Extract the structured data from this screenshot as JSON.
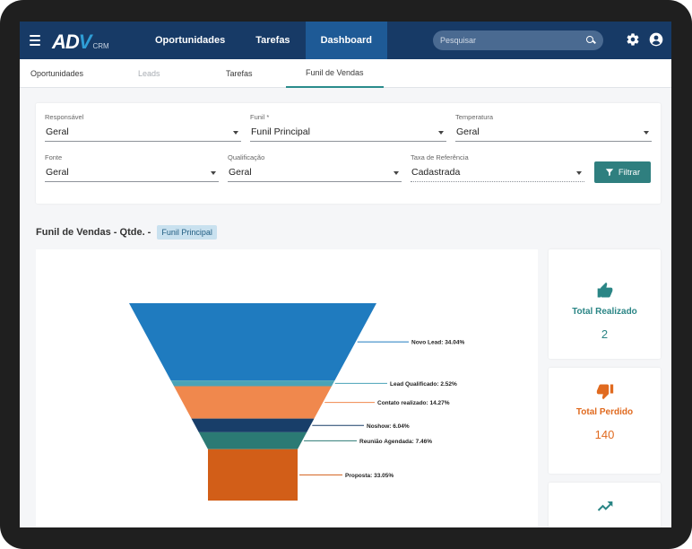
{
  "app": {
    "logo_text": "ADV",
    "logo_suffix": "CRM"
  },
  "nav": {
    "items": [
      {
        "label": "Oportunidades",
        "active": false
      },
      {
        "label": "Tarefas",
        "active": false
      },
      {
        "label": "Dashboard",
        "active": true
      }
    ]
  },
  "search": {
    "placeholder": "Pesquisar"
  },
  "subnav": {
    "tabs": [
      {
        "label": "Oportunidades",
        "state": "normal"
      },
      {
        "label": "Leads",
        "state": "disabled"
      },
      {
        "label": "Tarefas",
        "state": "normal"
      },
      {
        "label": "Funil de Vendas",
        "state": "active"
      }
    ]
  },
  "filters": {
    "responsavel": {
      "label": "Responsável",
      "value": "Geral"
    },
    "funil": {
      "label": "Funil *",
      "value": "Funil Principal"
    },
    "temperatura": {
      "label": "Temperatura",
      "value": "Geral"
    },
    "fonte": {
      "label": "Fonte",
      "value": "Geral"
    },
    "qualificacao": {
      "label": "Qualificação",
      "value": "Geral"
    },
    "taxa": {
      "label": "Taxa de Referência",
      "value": "Cadastrada"
    },
    "button_label": "Filtrar"
  },
  "section": {
    "title": "Funil de Vendas - Qtde. -",
    "badge": "Funil Principal"
  },
  "kpis": [
    {
      "label": "Total Realizado",
      "value": "2",
      "icon": "thumbs-up-icon",
      "color": "#2a8585"
    },
    {
      "label": "Total Perdido",
      "value": "140",
      "icon": "thumbs-down-icon",
      "color": "#e06a1f"
    },
    {
      "label": "",
      "value": "",
      "icon": "trend-up-icon",
      "color": "#2a8585"
    }
  ],
  "chart_data": {
    "type": "funnel",
    "categories": [
      "Novo Lead",
      "Lead Qualificado",
      "Contato realizado",
      "Noshow",
      "Reunião Agendada",
      "Proposta"
    ],
    "values": [
      34.04,
      2.52,
      14.27,
      6.04,
      7.46,
      33.05
    ],
    "data_labels": [
      "Novo Lead: 34.04%",
      "Lead Qualificado: 2.52%",
      "Contato realizado: 14.27%",
      "Noshow: 6.04%",
      "Reunião Agendada: 7.46%",
      "Proposta: 33.05%"
    ],
    "colors": [
      "#1f7bbf",
      "#4aa3b7",
      "#f0884d",
      "#183e69",
      "#2b7a74",
      "#d25e18"
    ],
    "unit": "%"
  }
}
